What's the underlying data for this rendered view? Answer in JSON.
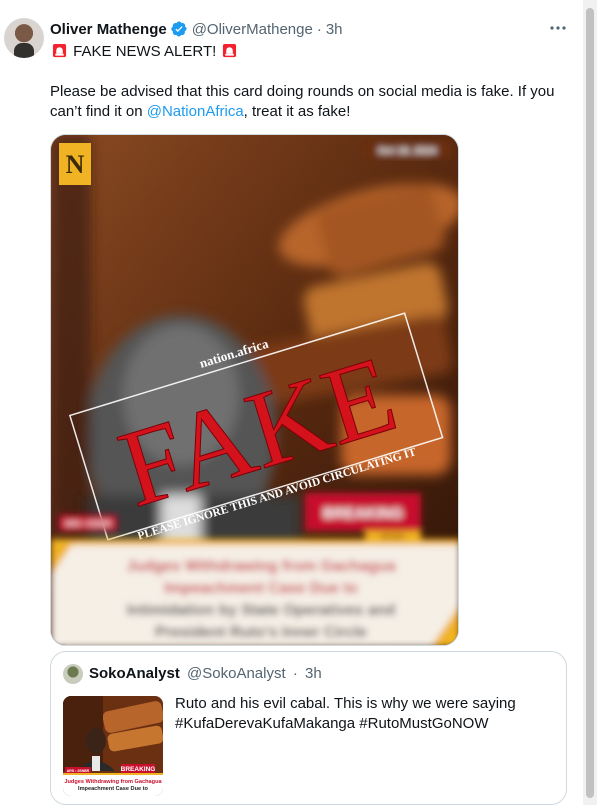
{
  "tweet": {
    "display_name": "Oliver Mathenge",
    "handle": "@OliverMathenge",
    "separator": "·",
    "time": "3h",
    "line1": "FAKE NEWS ALERT!",
    "line2_before": "Please be advised that this card doing rounds on social media is fake. If you can’t find it on ",
    "line2_mention": "@NationAfrica",
    "line2_after": ", treat it as fake!",
    "icons": [
      "verified-badge-icon",
      "siren-icon",
      "more-icon"
    ]
  },
  "media": {
    "logo_letter": "N",
    "date_chip": "Oct 18, 2024",
    "stamp_brand": "nation.africa",
    "stamp_word": "FAKE",
    "stamp_subtext": "PLEASE IGNORE THIS AND AVOID CIRCULATING IT",
    "breaking_label": "BREAKING",
    "breaking_sub": "NEWS",
    "left_chip": "DMS • 2SNBR",
    "headline_l1": "Judges Withdrawing from Gachagua",
    "headline_l2": "Impeachment Case Due to",
    "headline_l3": "Intimidation by State Operatives and",
    "headline_l4": "President Ruto's Inner Circle"
  },
  "quote": {
    "display_name": "SokoAnalyst",
    "handle": "@SokoAnalyst",
    "separator": "·",
    "time": "3h",
    "text_l1": "Ruto and his evil cabal. This is why we were saying",
    "text_l2": "#KufaDerevaKufaMakanga #RutoMustGoNOW",
    "thumb_breaking": "BREAKING",
    "thumb_chip": "ARS • 2SNBR",
    "thumb_head1": "Judges Withdrawing from Gachagua",
    "thumb_head2": "Impeachment Case Due to"
  },
  "colors": {
    "text": "#0f1419",
    "secondary": "#536471",
    "link": "#1d9bf0",
    "stamp_red": "#d4121b",
    "border": "#cfd9de"
  }
}
